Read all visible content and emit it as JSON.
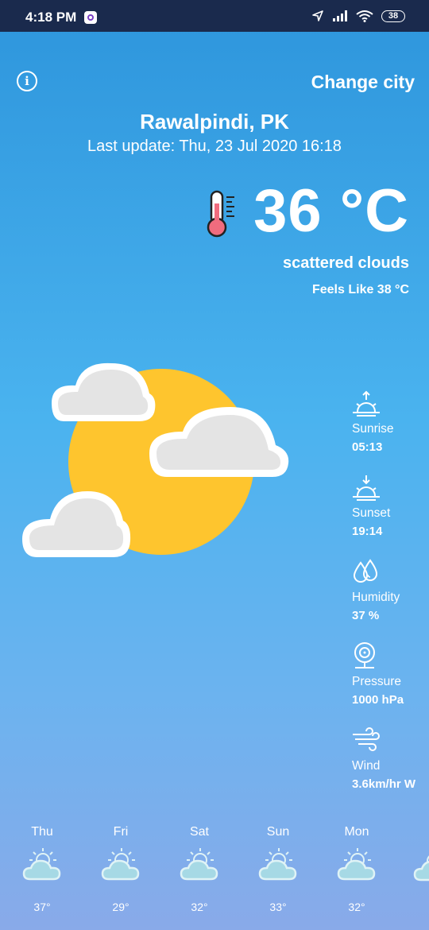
{
  "status": {
    "time": "4:18 PM",
    "battery": "38"
  },
  "header": {
    "info_label": "i",
    "change_city": "Change city"
  },
  "location": {
    "city": "Rawalpindi, PK",
    "last_update": "Last update: Thu, 23 Jul 2020 16:18"
  },
  "current": {
    "temperature": "36 °C",
    "description": "scattered clouds",
    "feels_like": "Feels Like 38 °C",
    "icon": "thermometer-icon"
  },
  "details": [
    {
      "label": "Sunrise",
      "value": "05:13",
      "icon": "sunrise-icon"
    },
    {
      "label": "Sunset",
      "value": "19:14",
      "icon": "sunset-icon"
    },
    {
      "label": "Humidity",
      "value": "37 %",
      "icon": "humidity-icon"
    },
    {
      "label": "Pressure",
      "value": "1000 hPa",
      "icon": "pressure-icon"
    },
    {
      "label": "Wind",
      "value": "3.6km/hr W",
      "icon": "wind-icon"
    }
  ],
  "forecast": [
    {
      "day": "Thu",
      "temp": "37°"
    },
    {
      "day": "Fri",
      "temp": "29°"
    },
    {
      "day": "Sat",
      "temp": "32°"
    },
    {
      "day": "Sun",
      "temp": "33°"
    },
    {
      "day": "Mon",
      "temp": "32°"
    }
  ],
  "colors": {
    "sun": "#fec52e",
    "cloud": "#e4e4e4",
    "status_bar": "#1a2a4d"
  }
}
